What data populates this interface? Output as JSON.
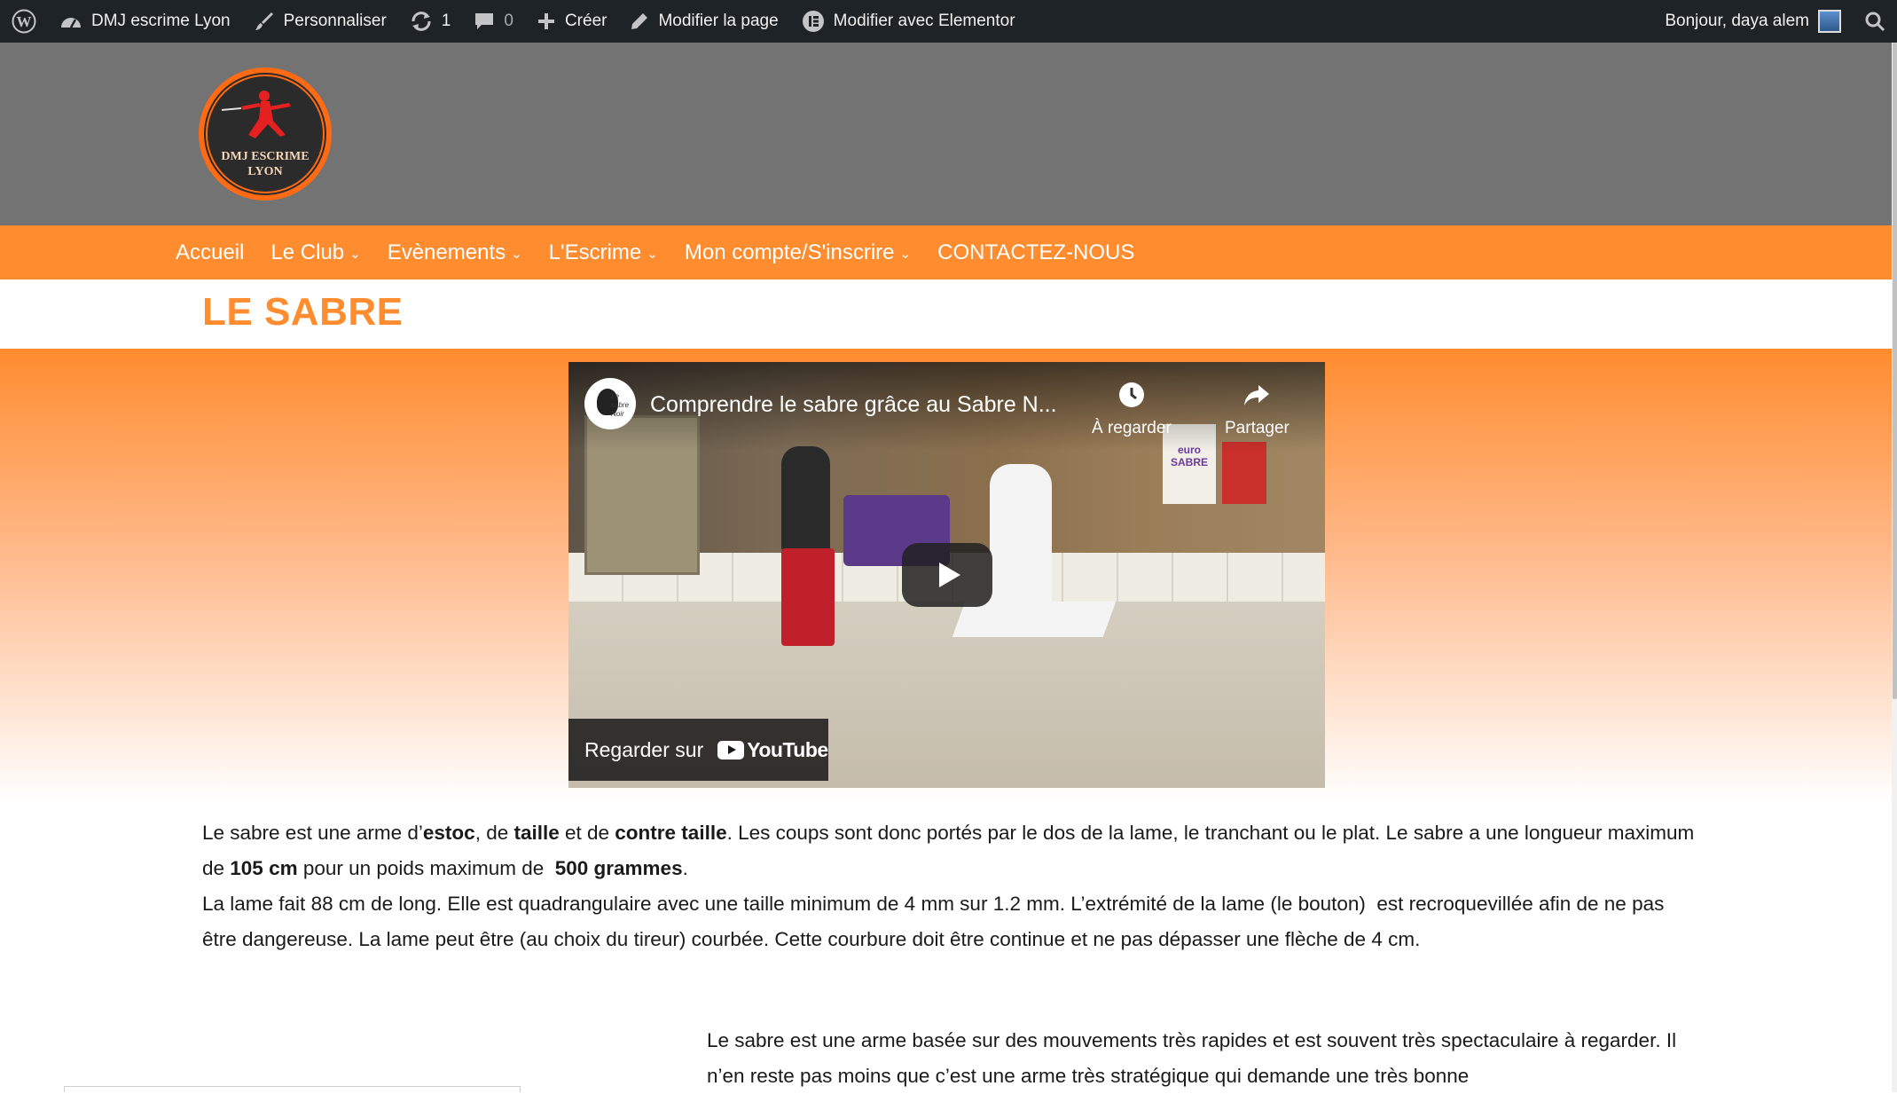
{
  "admin_bar": {
    "site_name": "DMJ escrime Lyon",
    "customize": "Personnaliser",
    "updates_count": "1",
    "comments_count": "0",
    "new": "Créer",
    "edit_page": "Modifier la page",
    "edit_elementor": "Modifier avec Elementor",
    "greeting": "Bonjour, daya alem"
  },
  "logo": {
    "line1": "DMJ ESCRIME",
    "line2": "LYON"
  },
  "nav": {
    "items": [
      {
        "label": "Accueil",
        "has_submenu": false
      },
      {
        "label": "Le Club",
        "has_submenu": true
      },
      {
        "label": "Evènements",
        "has_submenu": true
      },
      {
        "label": "L'Escrime",
        "has_submenu": true
      },
      {
        "label": "Mon compte/S'inscrire",
        "has_submenu": true
      },
      {
        "label": "CONTACTEZ-NOUS",
        "has_submenu": false
      }
    ]
  },
  "page": {
    "title": "LE SABRE"
  },
  "video": {
    "title": "Comprendre le sabre grâce au Sabre N...",
    "channel_logo_text": "Le sabre Noir",
    "watch_later": "À regarder",
    "share": "Partager",
    "watch_on": "Regarder sur",
    "youtube": "YouTube",
    "poster_text": "euro SABRE"
  },
  "article": {
    "p1": {
      "t1": "Le sabre est une arme d’",
      "b1": "estoc",
      "t2": ", de ",
      "b2": "taille",
      "t3": " et de ",
      "b3": "contre taille",
      "t4": ". Les coups sont donc portés par le dos de la lame, le tranchant ou le plat. Le sabre a une longueur maximum de ",
      "b4": "105 cm",
      "t5": " pour un poids maximum de  ",
      "b5": "500 grammes",
      "t6": "."
    },
    "p2": "La lame fait 88 cm de long. Elle est quadrangulaire avec une taille minimum de 4 mm sur 1.2 mm. L’extrémité de la lame (le bouton)  est recroquevillée afin de ne pas être dangereuse. La lame peut être (au choix du tireur) courbée. Cette courbure doit être continue et ne pas dépasser une flèche de 4 cm.",
    "p3": "Le sabre est une arme basée sur des mouvements très rapides et est souvent très spectaculaire à regarder. Il n’en reste pas moins que c’est une arme très stratégique qui demande une très bonne"
  },
  "colors": {
    "accent": "#ff8c2f",
    "admin_bar": "#1d2327",
    "header_bg": "#737373"
  }
}
